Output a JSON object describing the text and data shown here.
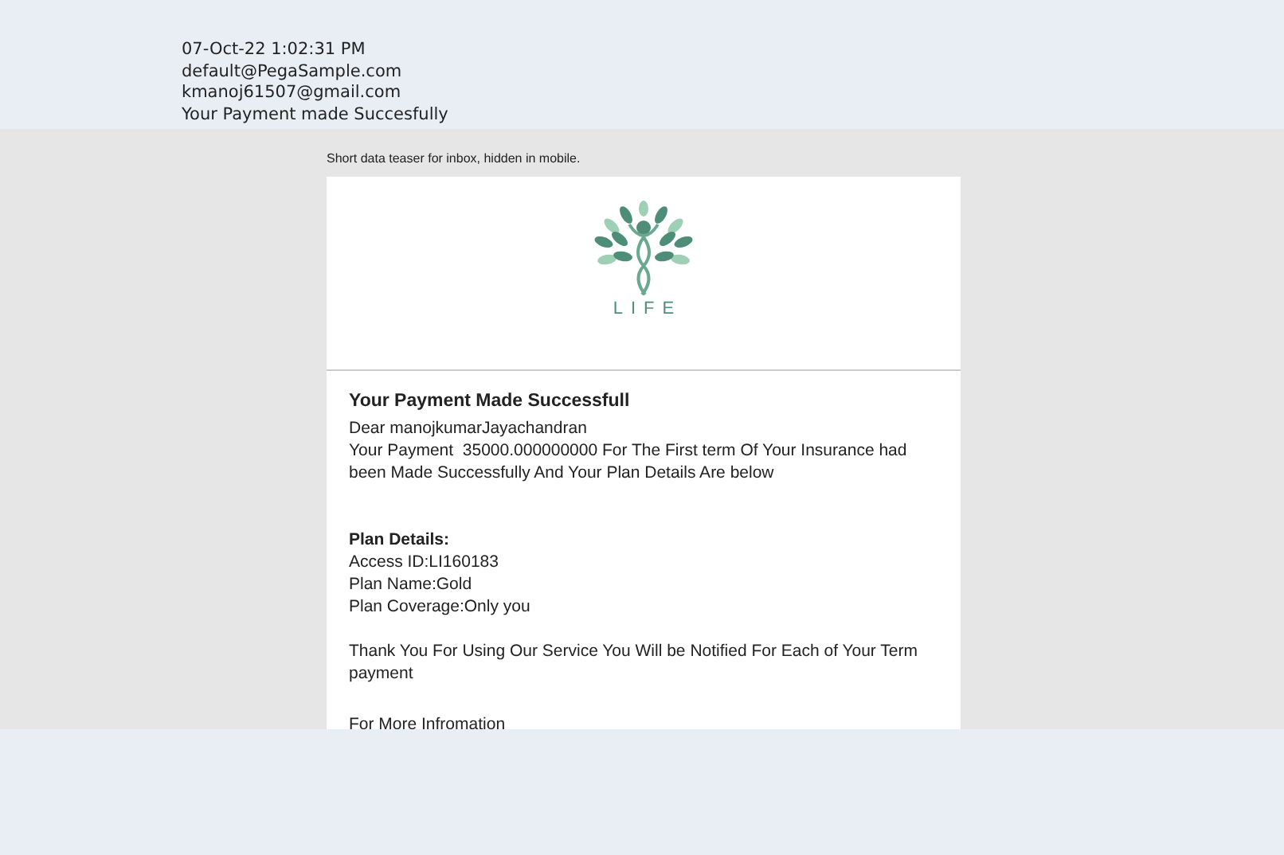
{
  "header": {
    "date": "07-Oct-22 1:02:31 PM",
    "from": "default@PegaSample.com",
    "to": "kmanoj61507@gmail.com",
    "subject": "Your Payment made Succesfully"
  },
  "teaser": "Short data teaser for inbox, hidden in mobile.",
  "logo": {
    "text": "LIFE"
  },
  "email": {
    "title": "Your Payment Made Successfull",
    "greeting": "Dear manojkumarJayachandran",
    "message": "Your Payment  35000.000000000 For The First term Of Your Insurance had been Made Successfully And Your Plan Details Are below",
    "plan_heading": "Plan Details:",
    "plan_lines": [
      "Access ID:LI160183",
      "Plan Name:Gold",
      "Plan Coverage:Only you"
    ],
    "thanks": "Thank You For Using Our Service You Will be Notified For Each of Your Term payment",
    "more": "For More Infromation"
  }
}
